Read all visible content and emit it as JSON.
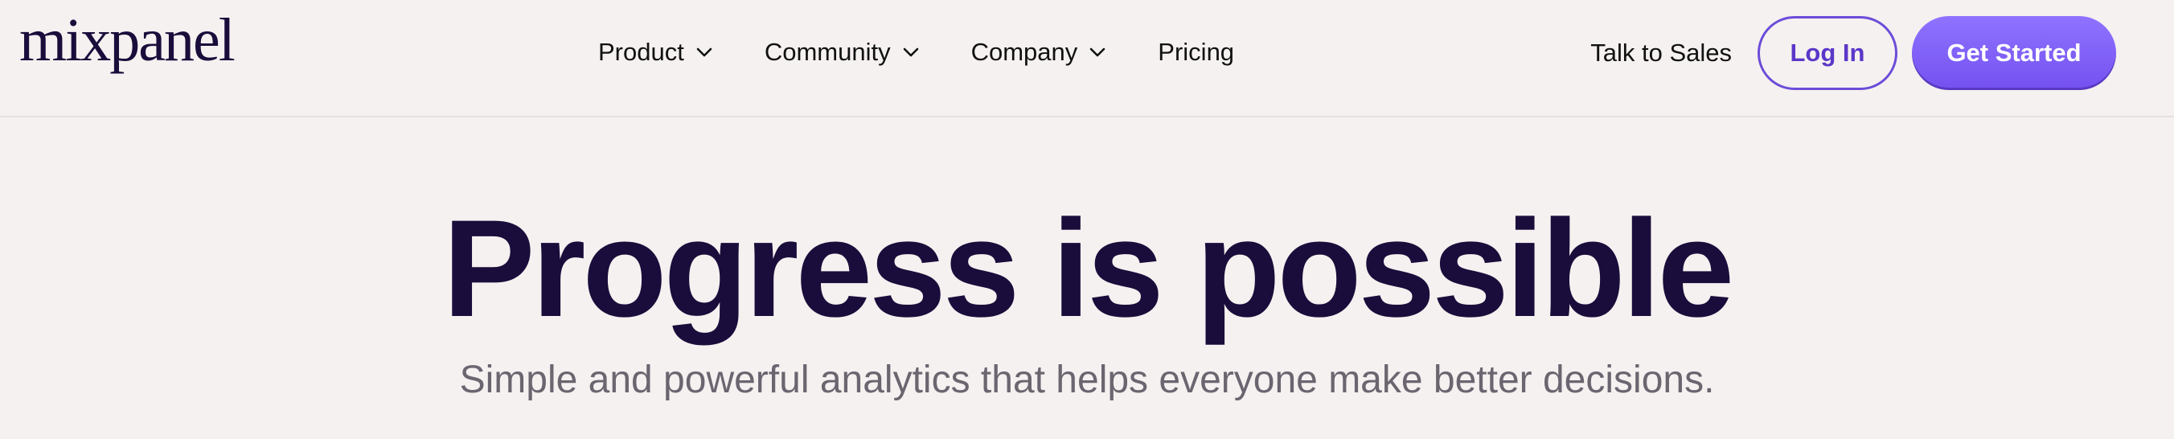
{
  "header": {
    "logo_text": "mixpanel",
    "nav": [
      {
        "label": "Product",
        "icon": "chevron-down-icon"
      },
      {
        "label": "Community",
        "icon": "chevron-down-icon"
      },
      {
        "label": "Company",
        "icon": "chevron-down-icon"
      },
      {
        "label": "Pricing"
      }
    ],
    "talk_to_sales": "Talk to Sales",
    "login_label": "Log In",
    "get_started_label": "Get Started"
  },
  "hero": {
    "title": "Progress is possible",
    "subtitle": "Simple and powerful analytics that helps everyone make better decisions."
  },
  "colors": {
    "background": "#f5f1f0",
    "brand_dark": "#1a0d3b",
    "accent": "#7451f0",
    "subtitle_gray": "#6b6570"
  }
}
